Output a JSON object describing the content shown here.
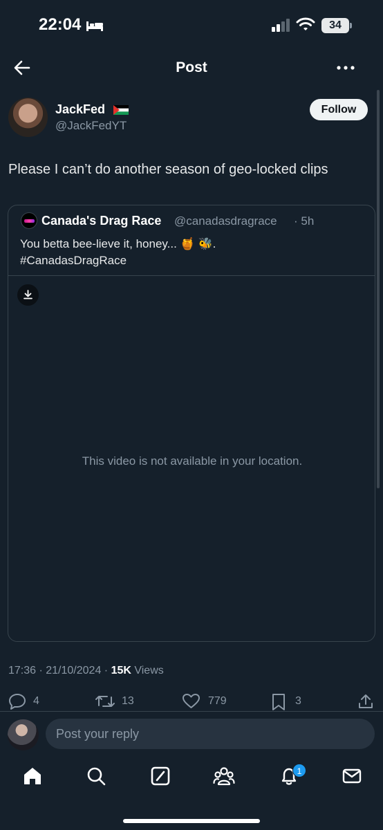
{
  "status_bar": {
    "time": "22:04",
    "battery": "34"
  },
  "header": {
    "title": "Post"
  },
  "author": {
    "name": "JackFed",
    "handle": "@JackFedYT",
    "follow_label": "Follow"
  },
  "post": {
    "text": "Please I can’t do another season of geo-locked clips"
  },
  "quote": {
    "name": "Canada's Drag Race",
    "handle": "@canadasdragrace",
    "time": "· 5h",
    "text_line1": "You betta bee-lieve it, honey... 🍯 🐝.",
    "text_line2": "#CanadasDragRace",
    "video_message": "This video is not available in your location."
  },
  "meta": {
    "timestamp": "17:36 · 21/10/2024 · ",
    "views_count": "15K",
    "views_label": " Views"
  },
  "actions": {
    "replies": "4",
    "reposts": "13",
    "likes": "779",
    "bookmarks": "3"
  },
  "reply": {
    "placeholder": "Post your reply"
  },
  "nav": {
    "notifications_badge": "1"
  },
  "colors": {
    "background": "#15202b",
    "accent": "#1d9bf0",
    "muted": "#8b98a5",
    "border": "#38444d"
  },
  "icons": [
    "back-arrow-icon",
    "more-icon",
    "flag-icon",
    "download-icon",
    "reply-icon",
    "repost-icon",
    "like-icon",
    "bookmark-icon",
    "share-icon",
    "home-icon",
    "search-icon",
    "grok-icon",
    "communities-icon",
    "notifications-icon",
    "messages-icon"
  ]
}
